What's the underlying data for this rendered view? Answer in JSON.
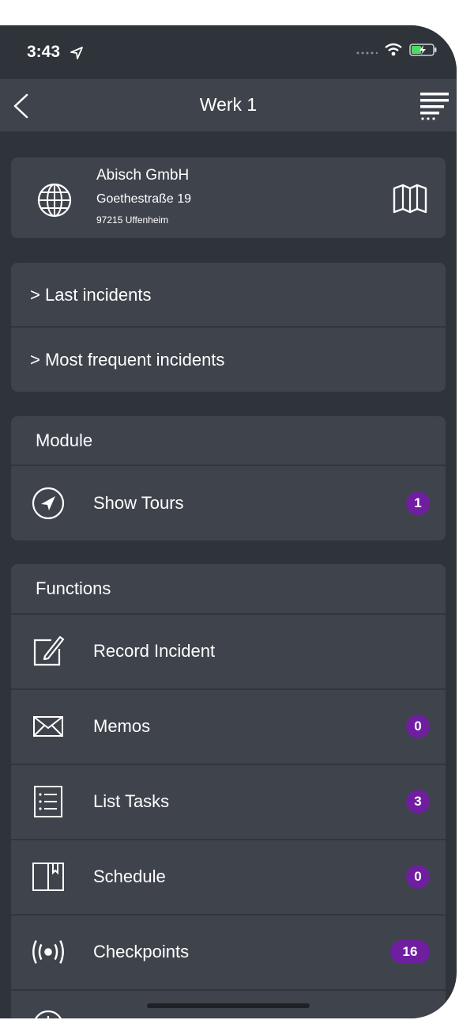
{
  "status": {
    "time": "3:43"
  },
  "nav": {
    "title": "Werk 1"
  },
  "address": {
    "name": "Abisch GmbH",
    "street": "Goethestraße 19",
    "city": "97215 Uffenheim"
  },
  "incidents": [
    {
      "label": "> Last incidents"
    },
    {
      "label": "> Most frequent incidents"
    }
  ],
  "module": {
    "heading": "Module",
    "items": [
      {
        "label": "Show Tours",
        "badge": "1",
        "icon": "navigation-icon"
      }
    ]
  },
  "functions": {
    "heading": "Functions",
    "items": [
      {
        "label": "Record Incident",
        "icon": "edit-icon"
      },
      {
        "label": "Memos",
        "badge": "0",
        "icon": "envelope-icon"
      },
      {
        "label": "List Tasks",
        "badge": "3",
        "icon": "list-icon"
      },
      {
        "label": "Schedule",
        "badge": "0",
        "icon": "book-icon"
      },
      {
        "label": "Checkpoints",
        "badge": "16",
        "icon": "broadcast-icon"
      }
    ]
  },
  "colors": {
    "background": "#2f333a",
    "card": "#3f444c",
    "badge": "#6f1ea0"
  }
}
